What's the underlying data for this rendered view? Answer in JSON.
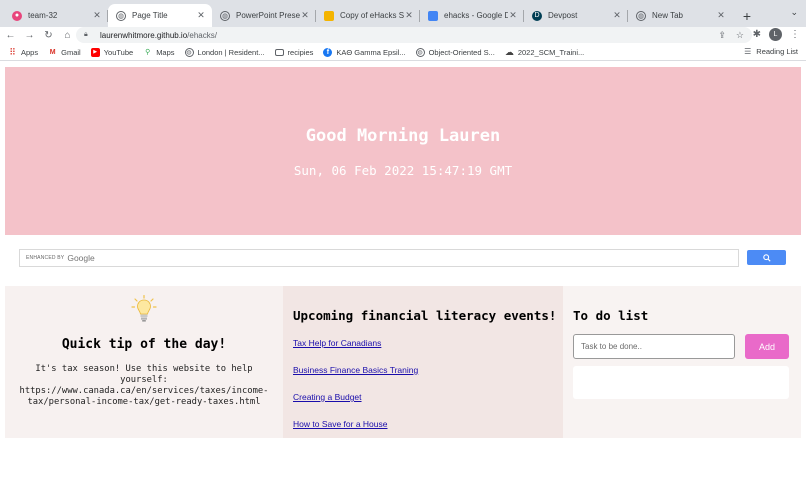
{
  "browser": {
    "tabs": [
      {
        "title": "team-32",
        "favicon": "github-icon",
        "color": "#e8457c"
      },
      {
        "title": "Page Title",
        "favicon": "globe-icon",
        "color": "#5f6368"
      },
      {
        "title": "PowerPoint Presentat",
        "favicon": "globe-icon",
        "color": "#5f6368"
      },
      {
        "title": "Copy of eHacks Slide",
        "favicon": "slides-icon",
        "color": "#f4b400"
      },
      {
        "title": "ehacks - Google Doc",
        "favicon": "docs-icon",
        "color": "#4285f4"
      },
      {
        "title": "Devpost",
        "favicon": "devpost-icon",
        "color": "#003e54"
      },
      {
        "title": "New Tab",
        "favicon": "chrome-icon",
        "color": "#5f6368"
      }
    ],
    "address": {
      "host": "laurenwhitmore.github.io",
      "path": "/ehacks/"
    },
    "profile_initial": "L",
    "bookmarks": [
      {
        "label": "Apps",
        "icon": "apps-grid-icon"
      },
      {
        "label": "Gmail",
        "icon": "gmail-icon"
      },
      {
        "label": "YouTube",
        "icon": "youtube-icon"
      },
      {
        "label": "Maps",
        "icon": "maps-pin-icon"
      },
      {
        "label": "London | Resident...",
        "icon": "globe-icon"
      },
      {
        "label": "recipies",
        "icon": "folder-icon"
      },
      {
        "label": "KAΘ Gamma Epsil...",
        "icon": "facebook-icon"
      },
      {
        "label": "Object-Oriented S...",
        "icon": "globe-icon"
      },
      {
        "label": "2022_SCM_Traini...",
        "icon": "cloud-icon"
      }
    ],
    "reading_list": "Reading List"
  },
  "hero": {
    "greeting": "Good Morning Lauren",
    "datetime": "Sun, 06 Feb 2022 15:47:19 GMT"
  },
  "search": {
    "enhanced_by": "ENHANCED BY",
    "brand": "Google"
  },
  "tip": {
    "heading": "Quick tip of the day!",
    "text": "It's tax season! Use this website to help yourself: https://www.canada.ca/en/services/taxes/income-tax/personal-income-tax/get-ready-taxes.html"
  },
  "events": {
    "heading": "Upcoming financial literacy events!",
    "items": [
      "Tax Help for Canadians",
      "Business Finance Basics Traning",
      "Creating a Budget",
      "How to Save for a House"
    ]
  },
  "todo": {
    "heading": "To do list",
    "placeholder": "Task to be done..",
    "add_label": "Add"
  }
}
